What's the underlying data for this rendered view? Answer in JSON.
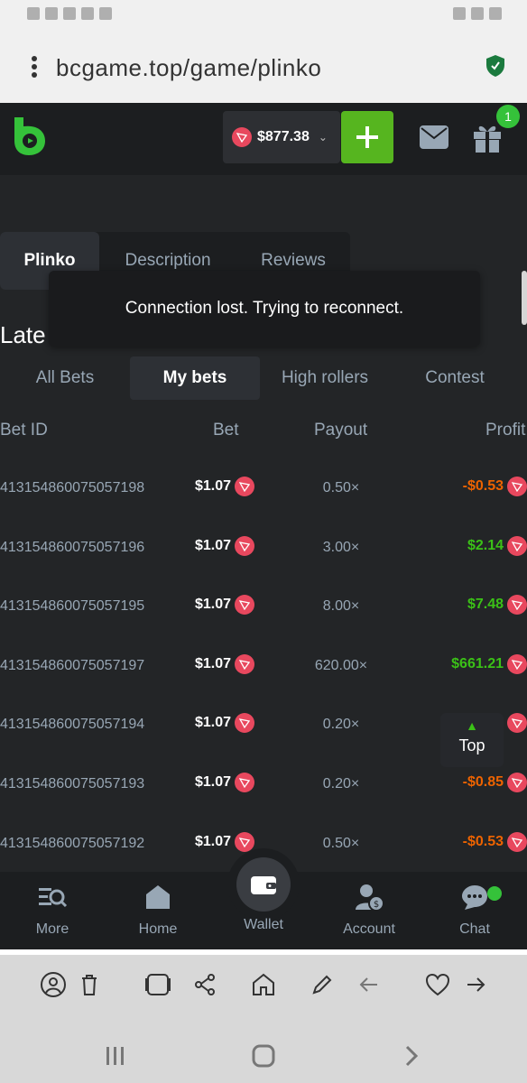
{
  "browser": {
    "url": "bcgame.top/game/plinko"
  },
  "header": {
    "balance": "$877.38",
    "gift_badge": "1",
    "colors": {
      "accent_green": "#56b51f",
      "trx_red": "#e8485e"
    }
  },
  "game_tabs": [
    {
      "label": "Plinko",
      "active": true
    },
    {
      "label": "Description",
      "active": false
    },
    {
      "label": "Reviews",
      "active": false
    }
  ],
  "toast": "Connection lost. Trying to reconnect.",
  "section_title": "Late",
  "bet_tabs": [
    {
      "label": "All Bets",
      "active": false
    },
    {
      "label": "My bets",
      "active": true
    },
    {
      "label": "High rollers",
      "active": false
    },
    {
      "label": "Contest",
      "active": false
    }
  ],
  "table": {
    "headers": {
      "id": "Bet ID",
      "bet": "Bet",
      "payout": "Payout",
      "profit": "Profit"
    },
    "rows": [
      {
        "id": "413154860075057198",
        "bet": "$1.07",
        "payout": "0.50×",
        "profit": "-$0.53",
        "sign": "neg"
      },
      {
        "id": "413154860075057196",
        "bet": "$1.07",
        "payout": "3.00×",
        "profit": "$2.14",
        "sign": "pos"
      },
      {
        "id": "413154860075057195",
        "bet": "$1.07",
        "payout": "8.00×",
        "profit": "$7.48",
        "sign": "pos"
      },
      {
        "id": "413154860075057197",
        "bet": "$1.07",
        "payout": "620.00×",
        "profit": "$661.21",
        "sign": "pos"
      },
      {
        "id": "413154860075057194",
        "bet": "$1.07",
        "payout": "0.20×",
        "profit": "",
        "sign": "neg"
      },
      {
        "id": "413154860075057193",
        "bet": "$1.07",
        "payout": "0.20×",
        "profit": "-$0.85",
        "sign": "neg"
      },
      {
        "id": "413154860075057192",
        "bet": "$1.07",
        "payout": "0.50×",
        "profit": "-$0.53",
        "sign": "neg"
      }
    ]
  },
  "top_button": "Top",
  "bottom_nav": [
    {
      "label": "More",
      "icon": "search-list-icon"
    },
    {
      "label": "Home",
      "icon": "home-icon"
    },
    {
      "label": "Wallet",
      "icon": "wallet-icon"
    },
    {
      "label": "Account",
      "icon": "account-icon"
    },
    {
      "label": "Chat",
      "icon": "chat-icon"
    }
  ]
}
